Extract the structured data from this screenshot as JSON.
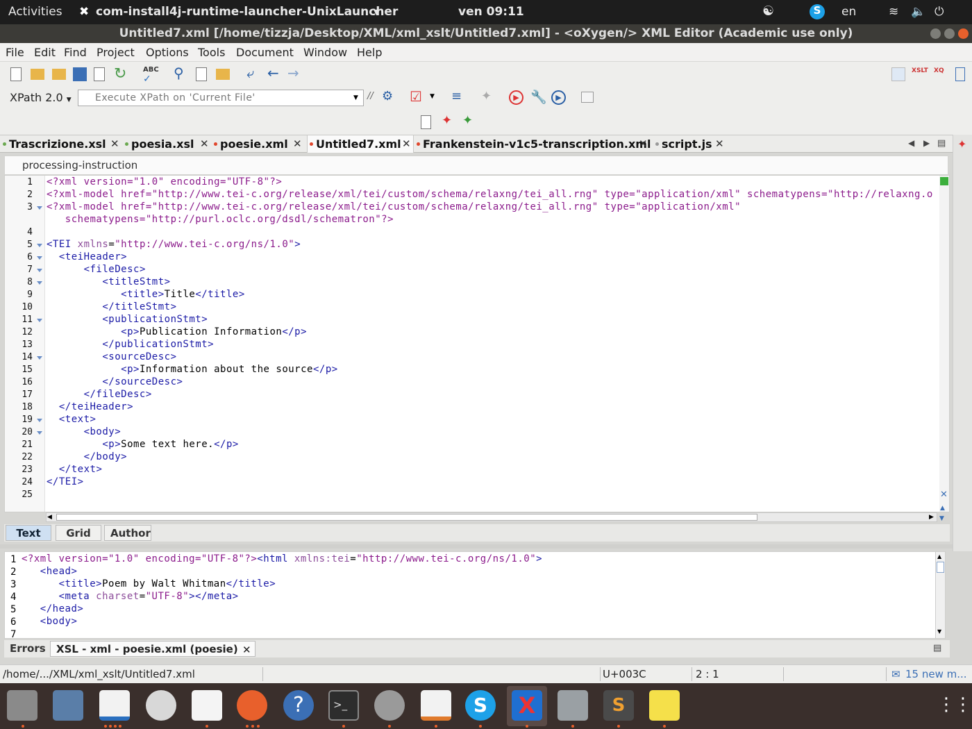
{
  "topbar": {
    "activities": "Activities",
    "app_name": "com-install4j-runtime-launcher-UnixLauncher",
    "clock": "ven 09:11",
    "lang": "en"
  },
  "window": {
    "title": "Untitled7.xml [/home/tizzja/Desktop/XML/xml_xslt/Untitled7.xml] - <oXygen/> XML Editor (Academic use only)"
  },
  "menu": [
    "File",
    "Edit",
    "Find",
    "Project",
    "Options",
    "Tools",
    "Document",
    "Window",
    "Help"
  ],
  "xpath": {
    "version": "XPath 2.0",
    "placeholder": "Execute XPath on  'Current File'"
  },
  "tabs": [
    {
      "label": "Trascrizione.xsl",
      "dot": "#6aa84f"
    },
    {
      "label": "poesia.xsl",
      "dot": "#6aa84f"
    },
    {
      "label": "poesie.xml",
      "dot": "#e0452b"
    },
    {
      "label": "Untitled7.xml",
      "dot": "#e0452b",
      "active": true
    },
    {
      "label": "Frankenstein-v1c5-transcription.xml",
      "dot": "#e0452b"
    },
    {
      "label": "script.js",
      "dot": "#999999"
    }
  ],
  "breadcrumb": "processing-instruction",
  "editor_lines": [
    {
      "n": "1",
      "text": "<?xml version=\"1.0\" encoding=\"UTF-8\"?>"
    },
    {
      "n": "2",
      "text": "<?xml-model href=\"http://www.tei-c.org/release/xml/tei/custom/schema/relaxng/tei_all.rng\" type=\"application/xml\" schematypens=\"http://relaxng.o"
    },
    {
      "n": "3",
      "text": "<?xml-model href=\"http://www.tei-c.org/release/xml/tei/custom/schema/relaxng/tei_all.rng\" type=\"application/xml\""
    },
    {
      "n": "",
      "text": "   schematypens=\"http://purl.oclc.org/dsdl/schematron\"?>"
    },
    {
      "n": "4",
      "text": ""
    },
    {
      "n": "5",
      "text": "<TEI xmlns=\"http://www.tei-c.org/ns/1.0\">"
    },
    {
      "n": "6",
      "text": "  <teiHeader>"
    },
    {
      "n": "7",
      "text": "      <fileDesc>"
    },
    {
      "n": "8",
      "text": "         <titleStmt>"
    },
    {
      "n": "9",
      "text": "            <title>Title</title>"
    },
    {
      "n": "10",
      "text": "         </titleStmt>"
    },
    {
      "n": "11",
      "text": "         <publicationStmt>"
    },
    {
      "n": "12",
      "text": "            <p>Publication Information</p>"
    },
    {
      "n": "13",
      "text": "         </publicationStmt>"
    },
    {
      "n": "14",
      "text": "         <sourceDesc>"
    },
    {
      "n": "15",
      "text": "            <p>Information about the source</p>"
    },
    {
      "n": "16",
      "text": "         </sourceDesc>"
    },
    {
      "n": "17",
      "text": "      </fileDesc>"
    },
    {
      "n": "18",
      "text": "  </teiHeader>"
    },
    {
      "n": "19",
      "text": "  <text>"
    },
    {
      "n": "20",
      "text": "      <body>"
    },
    {
      "n": "21",
      "text": "         <p>Some text here.</p>"
    },
    {
      "n": "22",
      "text": "      </body>"
    },
    {
      "n": "23",
      "text": "  </text>"
    },
    {
      "n": "24",
      "text": "</TEI>"
    },
    {
      "n": "25",
      "text": ""
    }
  ],
  "mode_tabs": [
    "Text",
    "Grid",
    "Author"
  ],
  "panel_lines": [
    {
      "n": "1",
      "text": "<?xml version=\"1.0\" encoding=\"UTF-8\"?><html xmlns:tei=\"http://www.tei-c.org/ns/1.0\">"
    },
    {
      "n": "2",
      "text": "   <head>"
    },
    {
      "n": "3",
      "text": "      <title>Poem by Walt Whitman</title>"
    },
    {
      "n": "4",
      "text": "      <meta charset=\"UTF-8\"></meta>"
    },
    {
      "n": "5",
      "text": "   </head>"
    },
    {
      "n": "6",
      "text": "   <body>"
    },
    {
      "n": "7",
      "text": ""
    }
  ],
  "panel_tabs": [
    "Errors",
    "XSL - xml - poesie.xml (poesie)"
  ],
  "status": {
    "path": "/home/.../XML/xml_xslt/Untitled7.xml",
    "unicode": "U+003C",
    "position": "2 : 1",
    "messages": "15 new m..."
  }
}
